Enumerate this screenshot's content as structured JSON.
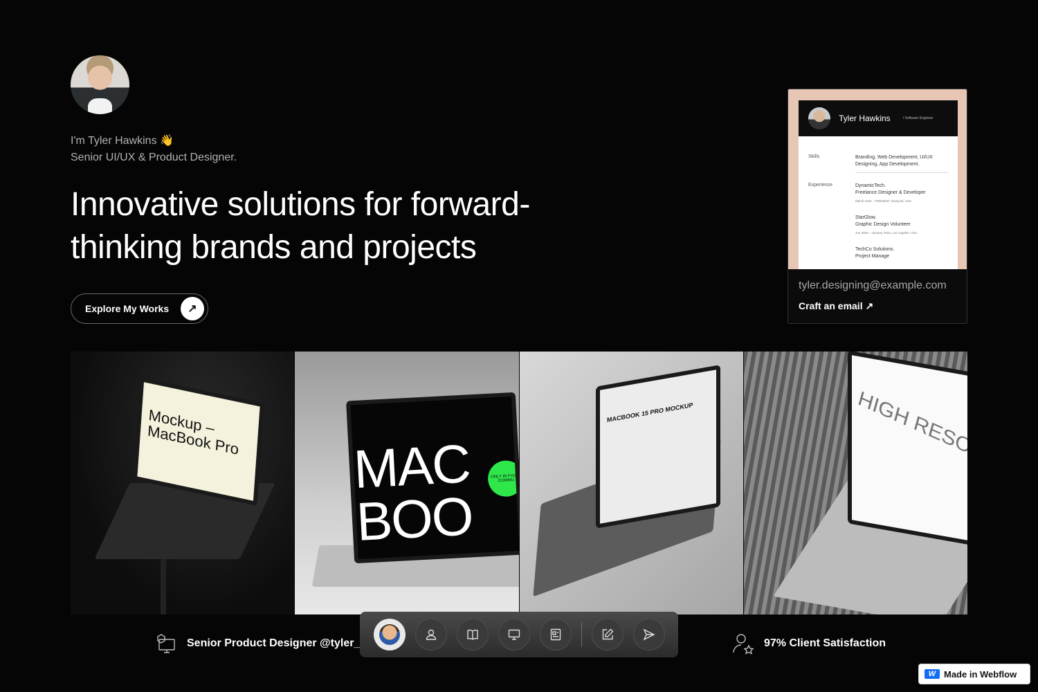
{
  "profile": {
    "intro_line1": "I'm Tyler Hawkins 👋",
    "intro_line2": "Senior UI/UX & Product Designer."
  },
  "hero": {
    "headline": "Innovative solutions for forward-thinking brands and projects",
    "cta_label": "Explore My Works",
    "cta_icon": "arrow-up-right-icon"
  },
  "resume_card": {
    "name": "Tyler Hawkins",
    "role": "/ Software Engineer",
    "skills_label": "Skills",
    "skills_value": "Branding, Web Development, UI/UX Designing, App Development.",
    "experience_label": "Experience",
    "experience": [
      {
        "company": "DynamicTech.",
        "title": "Freelance Designer & Developer",
        "meta": "March 2022 – PRESENT, Newyork, USA"
      },
      {
        "company": "StarGlow.",
        "title": "Graphic Design Volunteer",
        "meta": "Jun 2020 – January 2022, Los Angeles, USA"
      },
      {
        "company": "TechCo Solutions.",
        "title": "Project Manage",
        "meta": ""
      }
    ],
    "email": "tyler.designing@example.com",
    "craft_label": "Craft an email ↗"
  },
  "gallery": [
    {
      "screen_text": "Mockup – MacBook Pro"
    },
    {
      "screen_text": "MAC BOO",
      "badge": "ONLY IN FIGMA COMMU"
    },
    {
      "screen_text": "MACBOOK 15 PRO MOCKUP"
    },
    {
      "screen_text": "HIGH RESOLU"
    }
  ],
  "stats": {
    "left": "Senior Product Designer @tyler_h",
    "right": "97% Client Satisfaction"
  },
  "dock": {
    "items": [
      "avatar",
      "user-icon",
      "book-icon",
      "monitor-icon",
      "document-icon",
      "edit-icon",
      "send-icon"
    ]
  },
  "badge": {
    "label": "Made in Webflow"
  }
}
